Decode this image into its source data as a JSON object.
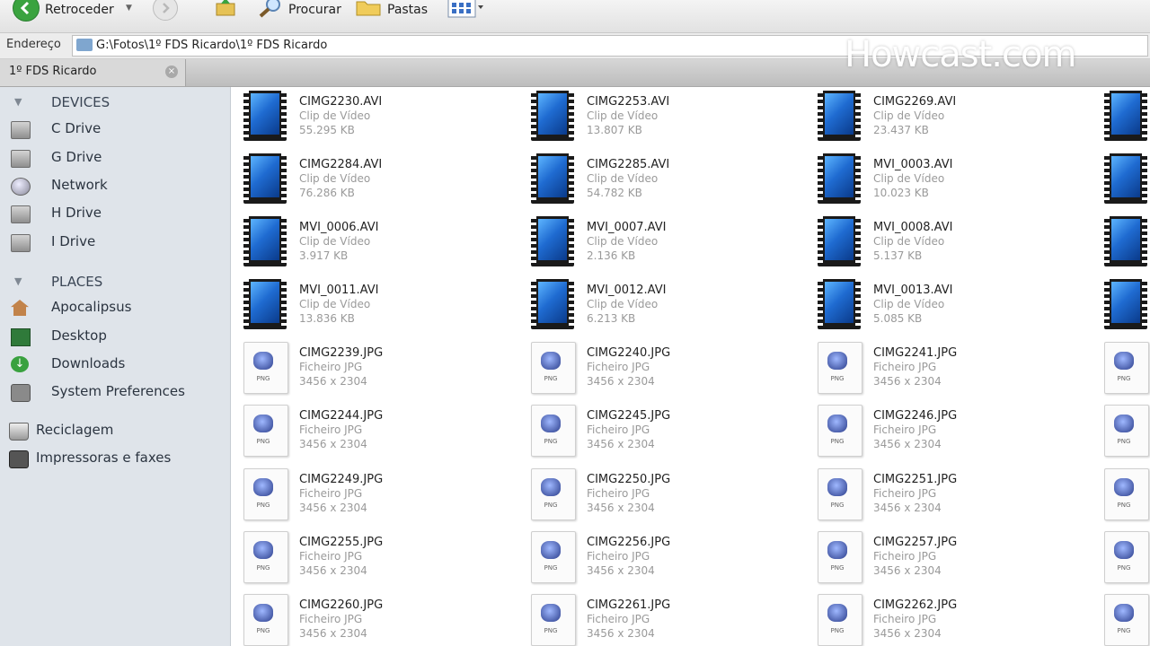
{
  "toolbar": {
    "back_label": "Retroceder",
    "search_label": "Procurar",
    "folders_label": "Pastas"
  },
  "address": {
    "label": "Endereço",
    "path": "G:\\Fotos\\1º FDS Ricardo\\1º FDS Ricardo"
  },
  "tab": {
    "label": "1º FDS Ricardo"
  },
  "watermark": "Howcast.com",
  "sidebar": {
    "devices_header": "DEVICES",
    "devices": [
      {
        "label": "C Drive",
        "icon": "drive-icon"
      },
      {
        "label": "G Drive",
        "icon": "drive-icon"
      },
      {
        "label": "Network",
        "icon": "network-icon"
      },
      {
        "label": "H Drive",
        "icon": "drive-icon"
      },
      {
        "label": "I Drive",
        "icon": "drive-icon"
      }
    ],
    "places_header": "PLACES",
    "places": [
      {
        "label": "Apocalipsus",
        "icon": "home-icon"
      },
      {
        "label": "Desktop",
        "icon": "desktop-icon"
      },
      {
        "label": "Downloads",
        "icon": "downloads-icon"
      },
      {
        "label": "System Preferences",
        "icon": "preferences-icon"
      }
    ],
    "extras": [
      {
        "label": "Reciclagem",
        "icon": "trash-icon"
      },
      {
        "label": "Impressoras e faxes",
        "icon": "printer-icon"
      }
    ]
  },
  "files": [
    {
      "name": "CIMG2230.AVI",
      "type": "Clip de Vídeo",
      "size": "55.295 KB",
      "kind": "video"
    },
    {
      "name": "CIMG2253.AVI",
      "type": "Clip de Vídeo",
      "size": "13.807 KB",
      "kind": "video"
    },
    {
      "name": "CIMG2269.AVI",
      "type": "Clip de Vídeo",
      "size": "23.437 KB",
      "kind": "video"
    },
    {
      "name": "",
      "type": "",
      "size": "",
      "kind": "video"
    },
    {
      "name": "CIMG2284.AVI",
      "type": "Clip de Vídeo",
      "size": "76.286 KB",
      "kind": "video"
    },
    {
      "name": "CIMG2285.AVI",
      "type": "Clip de Vídeo",
      "size": "54.782 KB",
      "kind": "video"
    },
    {
      "name": "MVI_0003.AVI",
      "type": "Clip de Vídeo",
      "size": "10.023 KB",
      "kind": "video"
    },
    {
      "name": "",
      "type": "",
      "size": "",
      "kind": "video"
    },
    {
      "name": "MVI_0006.AVI",
      "type": "Clip de Vídeo",
      "size": "3.917 KB",
      "kind": "video"
    },
    {
      "name": "MVI_0007.AVI",
      "type": "Clip de Vídeo",
      "size": "2.136 KB",
      "kind": "video"
    },
    {
      "name": "MVI_0008.AVI",
      "type": "Clip de Vídeo",
      "size": "5.137 KB",
      "kind": "video"
    },
    {
      "name": "",
      "type": "",
      "size": "",
      "kind": "video"
    },
    {
      "name": "MVI_0011.AVI",
      "type": "Clip de Vídeo",
      "size": "13.836 KB",
      "kind": "video"
    },
    {
      "name": "MVI_0012.AVI",
      "type": "Clip de Vídeo",
      "size": "6.213 KB",
      "kind": "video"
    },
    {
      "name": "MVI_0013.AVI",
      "type": "Clip de Vídeo",
      "size": "5.085 KB",
      "kind": "video"
    },
    {
      "name": "",
      "type": "",
      "size": "",
      "kind": "video"
    },
    {
      "name": "CIMG2239.JPG",
      "type": "Ficheiro JPG",
      "size": "3456 x 2304",
      "kind": "image"
    },
    {
      "name": "CIMG2240.JPG",
      "type": "Ficheiro JPG",
      "size": "3456 x 2304",
      "kind": "image"
    },
    {
      "name": "CIMG2241.JPG",
      "type": "Ficheiro JPG",
      "size": "3456 x 2304",
      "kind": "image"
    },
    {
      "name": "",
      "type": "",
      "size": "",
      "kind": "image"
    },
    {
      "name": "CIMG2244.JPG",
      "type": "Ficheiro JPG",
      "size": "3456 x 2304",
      "kind": "image"
    },
    {
      "name": "CIMG2245.JPG",
      "type": "Ficheiro JPG",
      "size": "3456 x 2304",
      "kind": "image"
    },
    {
      "name": "CIMG2246.JPG",
      "type": "Ficheiro JPG",
      "size": "3456 x 2304",
      "kind": "image"
    },
    {
      "name": "",
      "type": "",
      "size": "",
      "kind": "image"
    },
    {
      "name": "CIMG2249.JPG",
      "type": "Ficheiro JPG",
      "size": "3456 x 2304",
      "kind": "image"
    },
    {
      "name": "CIMG2250.JPG",
      "type": "Ficheiro JPG",
      "size": "3456 x 2304",
      "kind": "image"
    },
    {
      "name": "CIMG2251.JPG",
      "type": "Ficheiro JPG",
      "size": "3456 x 2304",
      "kind": "image"
    },
    {
      "name": "",
      "type": "",
      "size": "",
      "kind": "image"
    },
    {
      "name": "CIMG2255.JPG",
      "type": "Ficheiro JPG",
      "size": "3456 x 2304",
      "kind": "image"
    },
    {
      "name": "CIMG2256.JPG",
      "type": "Ficheiro JPG",
      "size": "3456 x 2304",
      "kind": "image"
    },
    {
      "name": "CIMG2257.JPG",
      "type": "Ficheiro JPG",
      "size": "3456 x 2304",
      "kind": "image"
    },
    {
      "name": "",
      "type": "",
      "size": "",
      "kind": "image"
    },
    {
      "name": "CIMG2260.JPG",
      "type": "Ficheiro JPG",
      "size": "3456 x 2304",
      "kind": "image"
    },
    {
      "name": "CIMG2261.JPG",
      "type": "Ficheiro JPG",
      "size": "3456 x 2304",
      "kind": "image"
    },
    {
      "name": "CIMG2262.JPG",
      "type": "Ficheiro JPG",
      "size": "3456 x 2304",
      "kind": "image"
    },
    {
      "name": "",
      "type": "",
      "size": "",
      "kind": "image"
    }
  ]
}
